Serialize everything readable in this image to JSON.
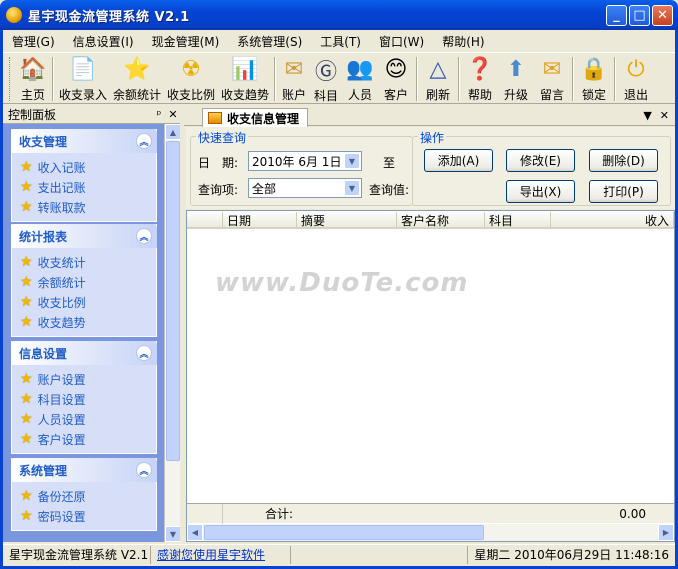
{
  "window": {
    "title": "星宇现金流管理系统 V2.1",
    "minimize": "_",
    "maximize": "□",
    "close": "✕"
  },
  "menu": [
    "管理(G)",
    "信息设置(I)",
    "现金管理(M)",
    "系统管理(S)",
    "工具(T)",
    "窗口(W)",
    "帮助(H)"
  ],
  "toolbar": [
    {
      "label": "主页",
      "icon": "home-icon",
      "glyph": "🏠"
    },
    {
      "label": "收支录入",
      "icon": "document-icon",
      "glyph": "📄"
    },
    {
      "label": "余额统计",
      "icon": "star-icon",
      "glyph": "⭐"
    },
    {
      "label": "收支比例",
      "icon": "pie-icon",
      "glyph": "☢"
    },
    {
      "label": "收支趋势",
      "icon": "trend-icon",
      "glyph": "📊"
    },
    {
      "label": "账户",
      "icon": "account-icon",
      "glyph": "✉"
    },
    {
      "label": "科目",
      "icon": "subject-icon",
      "glyph": "Ⓖ"
    },
    {
      "label": "人员",
      "icon": "people-icon",
      "glyph": "👥"
    },
    {
      "label": "客户",
      "icon": "customer-icon",
      "glyph": "😊"
    },
    {
      "label": "刷新",
      "icon": "refresh-icon",
      "glyph": "△"
    },
    {
      "label": "帮助",
      "icon": "help-icon",
      "glyph": "❓"
    },
    {
      "label": "升级",
      "icon": "upgrade-icon",
      "glyph": "⬆"
    },
    {
      "label": "留言",
      "icon": "message-icon",
      "glyph": "✉"
    },
    {
      "label": "锁定",
      "icon": "lock-icon",
      "glyph": "🔒"
    },
    {
      "label": "退出",
      "icon": "exit-icon",
      "glyph": "⏻"
    }
  ],
  "left": {
    "title": "控制面板",
    "pin": "ᵖ",
    "close": "✕",
    "groups": [
      {
        "title": "收支管理",
        "items": [
          "收入记账",
          "支出记账",
          "转账取款"
        ]
      },
      {
        "title": "统计报表",
        "items": [
          "收支统计",
          "余额统计",
          "收支比例",
          "收支趋势"
        ]
      },
      {
        "title": "信息设置",
        "items": [
          "账户设置",
          "科目设置",
          "人员设置",
          "客户设置"
        ]
      },
      {
        "title": "系统管理",
        "items": [
          "备份还原",
          "密码设置"
        ]
      }
    ]
  },
  "tab": {
    "label": "收支信息管理",
    "menu": "▼",
    "close": "✕"
  },
  "query": {
    "legend": "快速查询",
    "date_label": "日　期:",
    "date_value": "2010年 6月 1日",
    "to_label": "至",
    "item_label": "查询项:",
    "item_value": "全部",
    "value_label": "查询值:"
  },
  "ops": {
    "legend": "操作",
    "add": "添加(A)",
    "modify": "修改(E)",
    "delete": "删除(D)",
    "export": "导出(X)",
    "print": "打印(P)"
  },
  "grid": {
    "columns": [
      "日期",
      "摘要",
      "客户名称",
      "科目",
      "收入"
    ],
    "total_label": "合计:",
    "total_value": "0.00"
  },
  "watermark": "www.DuoTe.com",
  "status": {
    "app": "星宇现金流管理系统 V2.1",
    "link": "感谢您使用星宇软件",
    "datetime": "星期二 2010年06月29日 11:48:16"
  }
}
